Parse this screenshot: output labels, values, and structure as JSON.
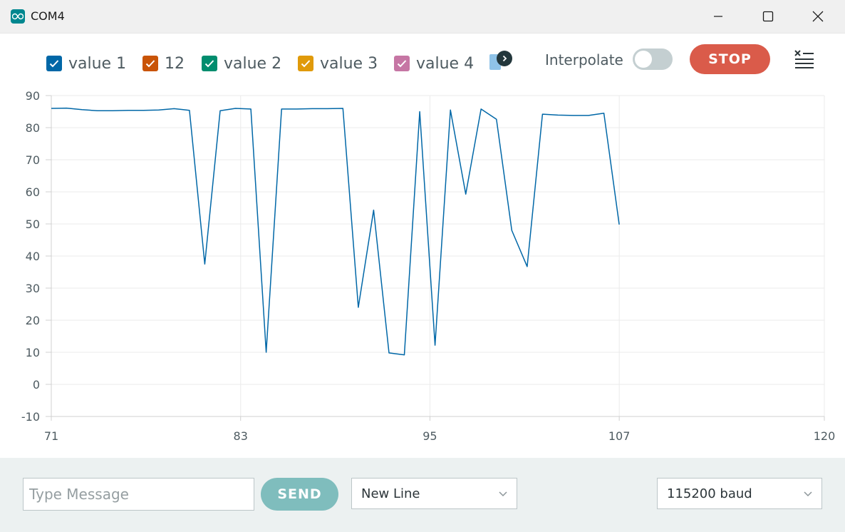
{
  "window": {
    "title": "COM4"
  },
  "legend": [
    {
      "label": "value 1",
      "color": "#0067a7"
    },
    {
      "label": "12",
      "color": "#c95407"
    },
    {
      "label": "value 2",
      "color": "#008d6e"
    },
    {
      "label": "value 3",
      "color": "#e09a0a"
    },
    {
      "label": "value 4",
      "color": "#c676a4"
    }
  ],
  "toolbar": {
    "interpolate_label": "Interpolate",
    "interpolate_on": false,
    "stop_label": "STOP"
  },
  "footer": {
    "message_placeholder": "Type Message",
    "send_label": "SEND",
    "line_ending": "New Line",
    "baud_rate": "115200 baud"
  },
  "chart_data": {
    "type": "line",
    "x": [
      71,
      72,
      73,
      74,
      75,
      76,
      77,
      78,
      79,
      80,
      81,
      82,
      83,
      84,
      85,
      86,
      87,
      88,
      89,
      90,
      91,
      92,
      93,
      94,
      95,
      96,
      97,
      98,
      99,
      100,
      101,
      102,
      103,
      104,
      105,
      106,
      107
    ],
    "series": [
      {
        "color": "#0067a7",
        "values": [
          86,
          86.1,
          85.6,
          85.3,
          85.3,
          85.4,
          85.4,
          85.5,
          85.9,
          85.4,
          37.5,
          85.3,
          86,
          85.8,
          10,
          85.8,
          85.8,
          85.9,
          85.9,
          86,
          24,
          54.3,
          9.8,
          9.2,
          85,
          12.2,
          85.5,
          59.3,
          85.8,
          82.6,
          48,
          36.7,
          84.2,
          83.9,
          83.8,
          83.8,
          84.5,
          49.8
        ]
      }
    ],
    "x_ticks": [
      71,
      83,
      95,
      107,
      120
    ],
    "y_ticks": [
      90,
      80,
      70,
      60,
      50,
      40,
      30,
      20,
      10,
      0,
      -10
    ],
    "xlim": [
      71,
      120
    ],
    "ylim": [
      -10,
      90
    ],
    "grid": true
  }
}
